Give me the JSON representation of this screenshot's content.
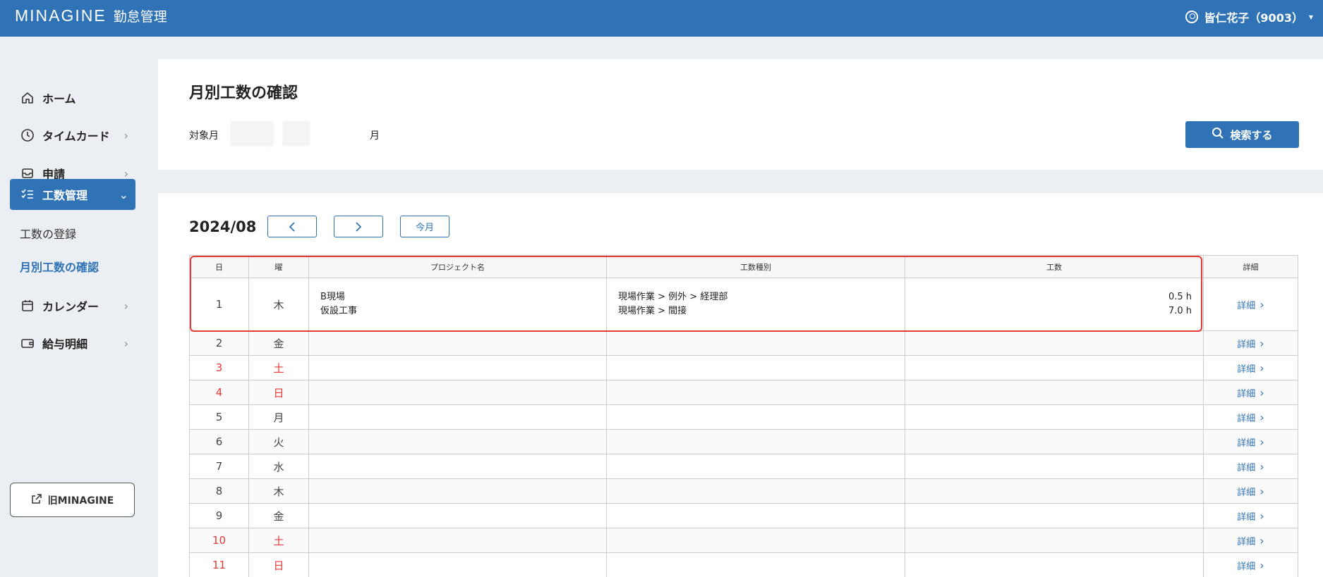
{
  "header": {
    "brand": "MINAGINE",
    "app_name": "勤怠管理",
    "user_name": "皆仁花子（9003）"
  },
  "sidebar": {
    "items": [
      {
        "label": "ホーム",
        "icon": "home-icon"
      },
      {
        "label": "タイムカード",
        "icon": "clock-icon"
      },
      {
        "label": "申請",
        "icon": "inbox-icon"
      },
      {
        "label": "工数管理",
        "icon": "checklist-icon",
        "active": true
      },
      {
        "label": "カレンダー",
        "icon": "calendar-icon"
      },
      {
        "label": "給与明細",
        "icon": "wallet-icon"
      }
    ],
    "sub_items": [
      {
        "label": "工数の登録"
      },
      {
        "label": "月別工数の確認",
        "current": true
      }
    ],
    "old_link_label": "旧MINAGINE"
  },
  "search": {
    "title": "月別工数の確認",
    "target_label": "対象月",
    "month_suffix": "月",
    "button_label": "検索する"
  },
  "results": {
    "year_month": "2024/08",
    "prev_glyph": "＜",
    "next_glyph": "＞",
    "current_month_label": "今月",
    "columns": [
      "日",
      "曜",
      "プロジェクト名",
      "工数種別",
      "工数",
      "詳細"
    ],
    "detail_label": "詳細",
    "rows": [
      {
        "day": "1",
        "dow": "木",
        "weekend": false,
        "projects": [
          "B現場",
          "仮設工事"
        ],
        "kinds": [
          "現場作業 > 例外 > 経理部",
          "現場作業 > 間接"
        ],
        "hours": [
          "0.5 h",
          "7.0 h"
        ]
      },
      {
        "day": "2",
        "dow": "金",
        "weekend": false,
        "projects": [],
        "kinds": [],
        "hours": []
      },
      {
        "day": "3",
        "dow": "土",
        "weekend": true,
        "projects": [],
        "kinds": [],
        "hours": []
      },
      {
        "day": "4",
        "dow": "日",
        "weekend": true,
        "projects": [],
        "kinds": [],
        "hours": []
      },
      {
        "day": "5",
        "dow": "月",
        "weekend": false,
        "projects": [],
        "kinds": [],
        "hours": []
      },
      {
        "day": "6",
        "dow": "火",
        "weekend": false,
        "projects": [],
        "kinds": [],
        "hours": []
      },
      {
        "day": "7",
        "dow": "水",
        "weekend": false,
        "projects": [],
        "kinds": [],
        "hours": []
      },
      {
        "day": "8",
        "dow": "木",
        "weekend": false,
        "projects": [],
        "kinds": [],
        "hours": []
      },
      {
        "day": "9",
        "dow": "金",
        "weekend": false,
        "projects": [],
        "kinds": [],
        "hours": []
      },
      {
        "day": "10",
        "dow": "土",
        "weekend": true,
        "projects": [],
        "kinds": [],
        "hours": []
      },
      {
        "day": "11",
        "dow": "日",
        "weekend": true,
        "projects": [],
        "kinds": [],
        "hours": []
      }
    ]
  },
  "colors": {
    "brand_blue": "#2f73b6",
    "weekend_red": "#e53935",
    "highlight_red": "#e53935"
  }
}
